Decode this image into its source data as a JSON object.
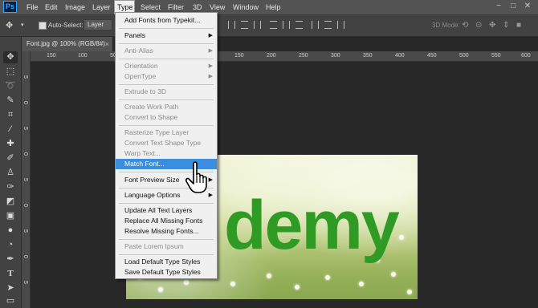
{
  "app": {
    "logo": "Ps"
  },
  "menubar": {
    "items": [
      "File",
      "Edit",
      "Image",
      "Layer",
      "Type",
      "Select",
      "Filter",
      "3D",
      "View",
      "Window",
      "Help"
    ],
    "active": "Type"
  },
  "window_controls": {
    "minimize": "−",
    "maximize": "□",
    "close": "✕"
  },
  "options_bar": {
    "auto_select_label": "Auto-Select:",
    "auto_select_value": "Layer",
    "mode_3d": "3D Mode:"
  },
  "document": {
    "tab_label": "Font.jpg @ 100% (RGB/8#)",
    "close_glyph": "×",
    "image_text": "demy"
  },
  "ruler": {
    "top_ticks": [
      "150",
      "100",
      "50",
      "0",
      "50",
      "100",
      "150",
      "200",
      "250",
      "300",
      "350",
      "400",
      "450",
      "500",
      "550",
      "600"
    ],
    "left_ticks": [
      "5",
      "0",
      "5",
      "0",
      "5",
      "0",
      "5",
      "0",
      "5",
      "0"
    ]
  },
  "type_menu": {
    "items": [
      {
        "label": "Add Fonts from Typekit...",
        "disabled": false
      },
      {
        "label": "Panels",
        "disabled": false,
        "submenu": true
      },
      {
        "label": "Anti-Alias",
        "disabled": true,
        "submenu": true
      },
      {
        "label": "Orientation",
        "disabled": true,
        "submenu": true
      },
      {
        "label": "OpenType",
        "disabled": true,
        "submenu": true
      },
      {
        "label": "Extrude to 3D",
        "disabled": true
      },
      {
        "label": "Create Work Path",
        "disabled": true
      },
      {
        "label": "Convert to Shape",
        "disabled": true
      },
      {
        "label": "Rasterize Type Layer",
        "disabled": true
      },
      {
        "label": "Convert Text Shape Type",
        "disabled": true
      },
      {
        "label": "Warp Text...",
        "disabled": true
      },
      {
        "label": "Match Font...",
        "disabled": false,
        "highlighted": true
      },
      {
        "label": "Font Preview Size",
        "disabled": false,
        "submenu": true
      },
      {
        "label": "Language Options",
        "disabled": false,
        "submenu": true
      },
      {
        "label": "Update All Text Layers",
        "disabled": false
      },
      {
        "label": "Replace All Missing Fonts",
        "disabled": false
      },
      {
        "label": "Resolve Missing Fonts...",
        "disabled": false
      },
      {
        "label": "Paste Lorem Ipsum",
        "disabled": true
      },
      {
        "label": "Load Default Type Styles",
        "disabled": false
      },
      {
        "label": "Save Default Type Styles",
        "disabled": false
      }
    ],
    "submenu_arrow": "▶"
  },
  "colors": {
    "highlight": "#3b8ede",
    "menubar_bg": "#535353",
    "panel_bg": "#424242",
    "canvas_bg": "#282828",
    "image_text": "#2f9a24"
  },
  "tools": [
    "move-icon",
    "marquee-icon",
    "lasso-icon",
    "quick-select-icon",
    "crop-icon",
    "eyedropper-icon",
    "healing-icon",
    "brush-icon",
    "stamp-icon",
    "history-brush-icon",
    "eraser-icon",
    "gradient-icon",
    "blur-icon",
    "dodge-icon",
    "pen-icon",
    "type-icon",
    "path-select-icon"
  ]
}
